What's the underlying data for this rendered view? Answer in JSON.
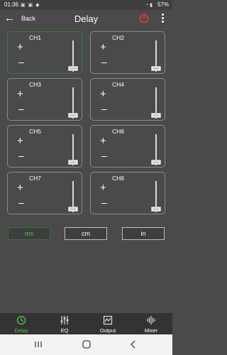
{
  "status_bar": {
    "time": "01:36",
    "battery": "57%",
    "left_icons": [
      "notification-icon",
      "notification-icon",
      "notification-icon"
    ],
    "right_icons": [
      "wifi-icon",
      "signal-icon"
    ]
  },
  "header": {
    "back_label": "Back",
    "title": "Delay"
  },
  "channels": [
    {
      "label": "CH1",
      "plus": "+",
      "minus": "–",
      "level": 0
    },
    {
      "label": "CH2",
      "plus": "+",
      "minus": "–",
      "level": 0
    },
    {
      "label": "CH3",
      "plus": "+",
      "minus": "–",
      "level": 0
    },
    {
      "label": "CH4",
      "plus": "+",
      "minus": "–",
      "level": 0
    },
    {
      "label": "CH5",
      "plus": "+",
      "minus": "–",
      "level": 0
    },
    {
      "label": "CH6",
      "plus": "+",
      "minus": "–",
      "level": 0
    },
    {
      "label": "CH7",
      "plus": "+",
      "minus": "–",
      "level": 0
    },
    {
      "label": "CH8",
      "plus": "+",
      "minus": "–",
      "level": 0
    }
  ],
  "units": {
    "options": [
      "ms",
      "cm",
      "in"
    ],
    "selected": "ms"
  },
  "bottom_nav": {
    "items": [
      {
        "label": "Delay",
        "icon": "clock-icon",
        "active": true
      },
      {
        "label": "EQ",
        "icon": "equalizer-icon",
        "active": false
      },
      {
        "label": "Output",
        "icon": "output-icon",
        "active": false
      },
      {
        "label": "Mixer",
        "icon": "waveform-icon",
        "active": false
      }
    ]
  },
  "colors": {
    "accent": "#4fc14f",
    "power": "#e53935",
    "background": "#4a4a4a"
  }
}
